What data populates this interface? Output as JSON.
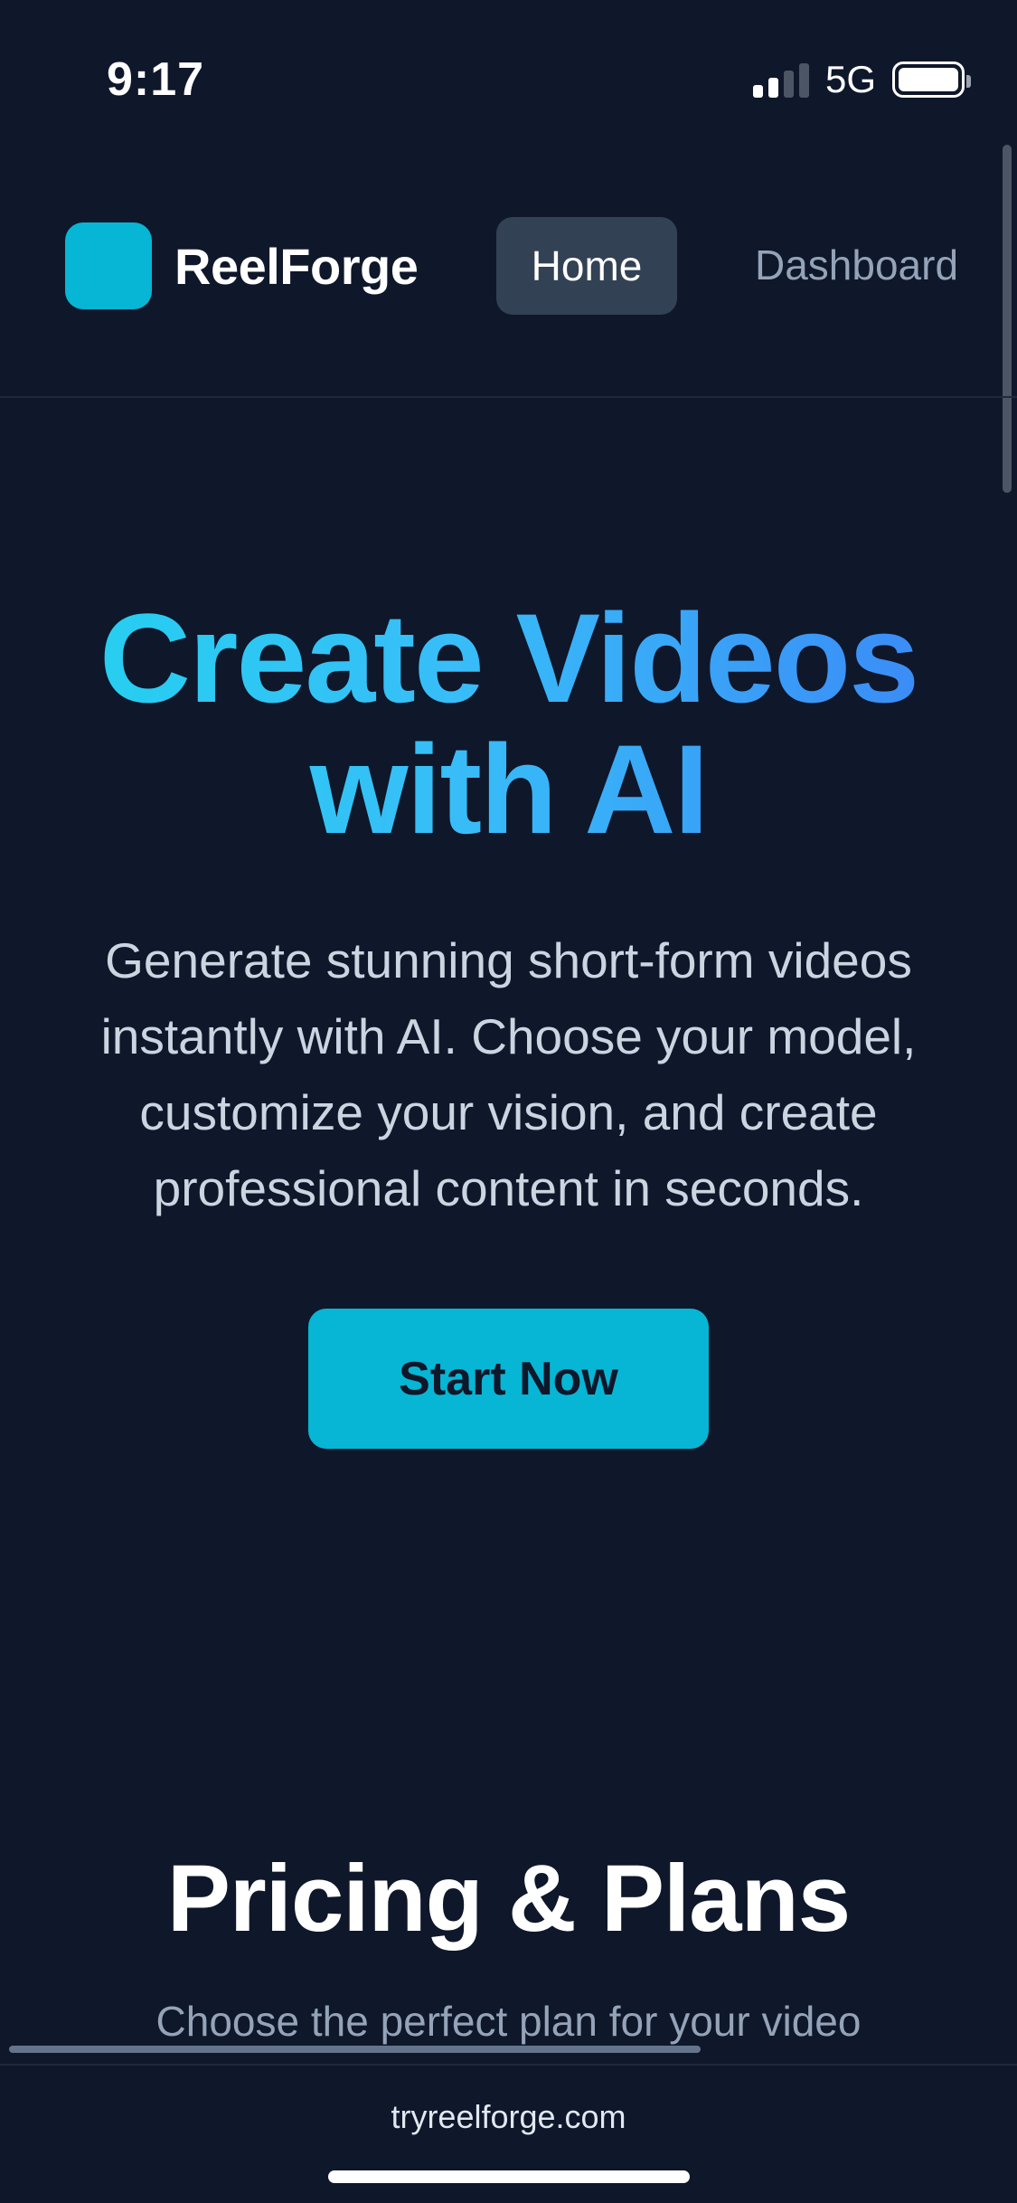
{
  "status_bar": {
    "time": "9:17",
    "network": "5G",
    "signal_bars_active": 2,
    "signal_bars_total": 4,
    "battery_level": 1.0
  },
  "nav": {
    "brand": "ReelForge",
    "brand_color": "#06b6d4",
    "home_label": "Home",
    "dashboard_label": "Dashboard"
  },
  "hero": {
    "title_line1": "Create Videos",
    "title_line2": "with AI",
    "description": "Generate stunning short-form videos instantly with AI. Choose your model, customize your vision, and create professional content in seconds.",
    "cta_label": "Start Now",
    "gradient_start": "#22d3ee",
    "gradient_end": "#3b82f6"
  },
  "pricing": {
    "title": "Pricing & Plans",
    "subtitle": "Choose the perfect plan for your video"
  },
  "browser": {
    "url": "tryreelforge.com"
  },
  "colors": {
    "background": "#0f172a",
    "accent": "#06b6d4",
    "nav_active_bg": "#334155"
  }
}
